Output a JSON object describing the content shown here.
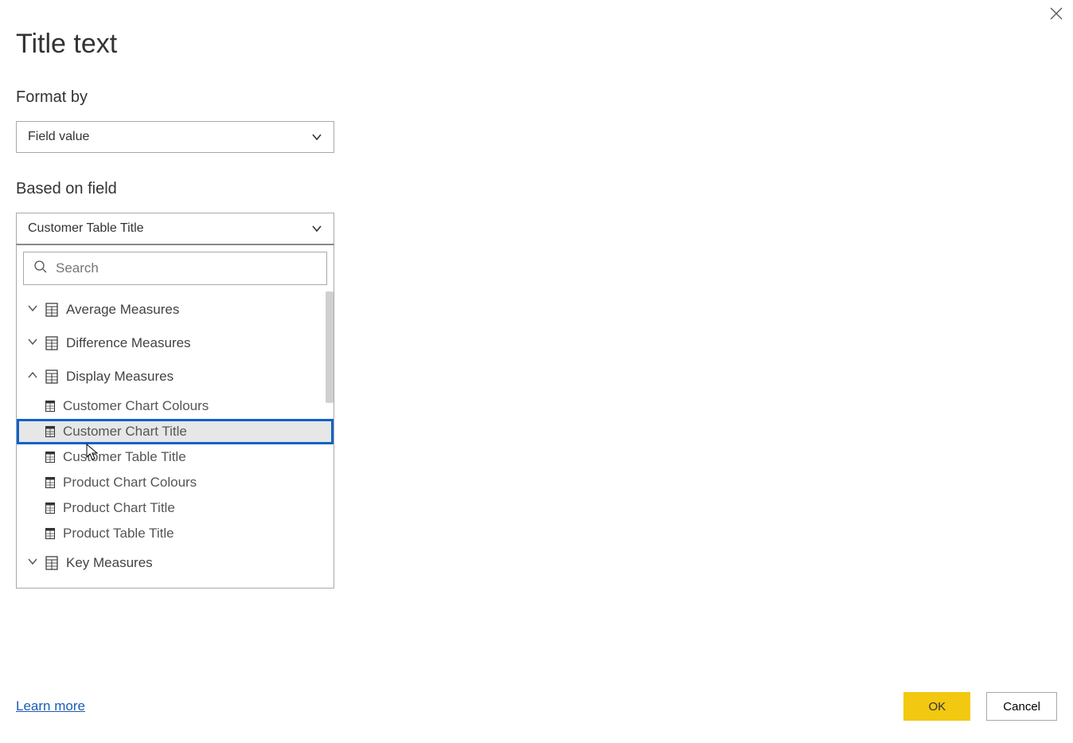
{
  "dialog": {
    "title": "Title text"
  },
  "format_by": {
    "label": "Format by",
    "value": "Field value"
  },
  "based_on_field": {
    "label": "Based on field",
    "value": "Customer Table Title"
  },
  "search": {
    "placeholder": "Search"
  },
  "tree": {
    "groups": [
      {
        "label": "Average Measures",
        "expanded": false
      },
      {
        "label": "Difference Measures",
        "expanded": false
      },
      {
        "label": "Display Measures",
        "expanded": true
      },
      {
        "label": "Key Measures",
        "expanded": false
      }
    ],
    "display_measures_children": [
      {
        "label": "Customer Chart Colours",
        "selected": false
      },
      {
        "label": "Customer Chart Title",
        "selected": true
      },
      {
        "label": "Customer Table Title",
        "selected": false
      },
      {
        "label": "Product Chart Colours",
        "selected": false
      },
      {
        "label": "Product Chart Title",
        "selected": false
      },
      {
        "label": "Product Table Title",
        "selected": false
      }
    ]
  },
  "footer": {
    "learn_more": "Learn more",
    "ok": "OK",
    "cancel": "Cancel"
  },
  "colors": {
    "primary_yellow": "#f2c811",
    "selection_blue": "#0f62c9",
    "link_blue": "#1a5db2"
  }
}
